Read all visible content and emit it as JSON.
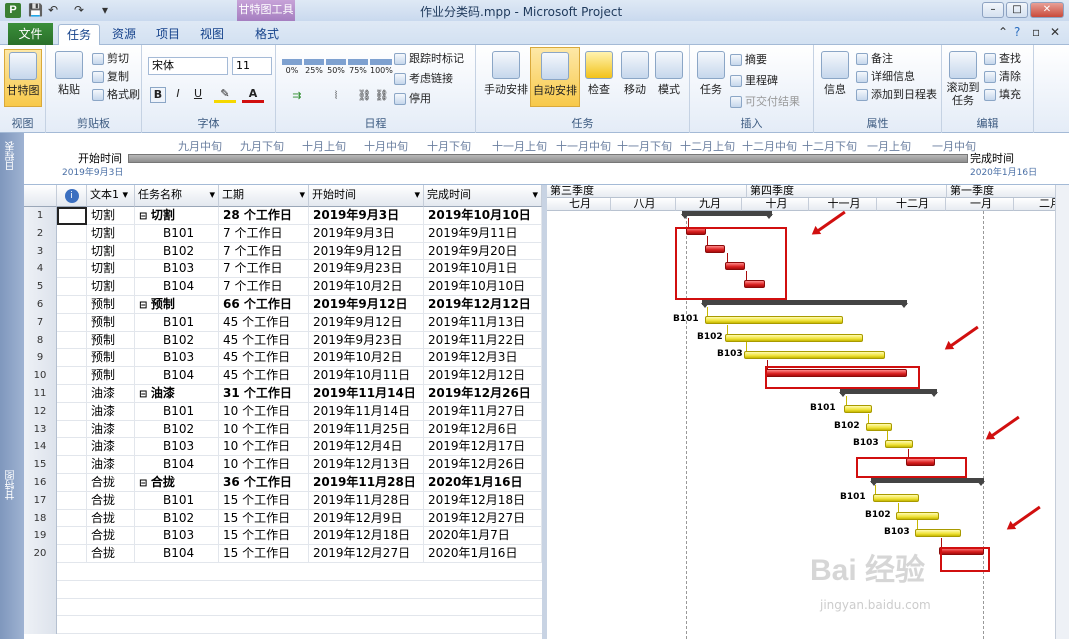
{
  "titlebar": {
    "app_icon": "P",
    "ctx_tab": "甘特图工具",
    "title": "作业分类码.mpp - Microsoft Project",
    "qat": [
      "save-icon",
      "undo-icon",
      "redo-icon",
      "customize-icon"
    ]
  },
  "tabs": [
    "文件",
    "任务",
    "资源",
    "项目",
    "视图",
    "格式"
  ],
  "ribbon": {
    "view_group": {
      "label": "视图",
      "button": "甘特图"
    },
    "clipboard": {
      "label": "剪贴板",
      "paste": "粘贴",
      "cut": "剪切",
      "copy": "复制",
      "format_painter": "格式刷"
    },
    "font": {
      "label": "字体",
      "font_name": "宋体",
      "font_size": "11",
      "bold": "B",
      "italic": "I",
      "underline": "U"
    },
    "schedule": {
      "label": "日程",
      "pcts": [
        "0%",
        "25%",
        "50%",
        "75%",
        "100%"
      ],
      "track": "跟踪时标记",
      "respect": "考虑链接",
      "inactivate": "停用"
    },
    "tasks": {
      "label": "任务",
      "manual": "手动安排",
      "auto": "自动安排",
      "inspect": "检查",
      "move": "移动",
      "mode": "模式"
    },
    "insert": {
      "label": "插入",
      "task": "任务",
      "summary": "摘要",
      "milestone": "里程碑",
      "deliverable": "可交付结果"
    },
    "properties": {
      "label": "属性",
      "info": "信息",
      "notes": "备注",
      "details": "详细信息",
      "add_timeline": "添加到日程表"
    },
    "editing": {
      "label": "编辑",
      "scroll": "滚动到任务",
      "find": "查找",
      "clear": "清除",
      "fill": "填充"
    }
  },
  "timeline": {
    "side_label": "日程表",
    "start_label": "开始时间",
    "start_date": "2019年9月3日",
    "finish_label": "完成时间",
    "finish_date": "2020年1月16日",
    "months": [
      "九月中旬",
      "九月下旬",
      "十月上旬",
      "十月中旬",
      "十月下旬",
      "十一月上旬",
      "十一月中旬",
      "十一月下旬",
      "十二月上旬",
      "十二月中旬",
      "十二月下旬",
      "一月上旬",
      "一月中旬"
    ]
  },
  "grid": {
    "side_label": "甘特图",
    "headers": {
      "info": "i",
      "text1": "文本1",
      "name": "任务名称",
      "duration": "工期",
      "start": "开始时间",
      "finish": "完成时间"
    },
    "rows": [
      {
        "n": "1",
        "t": "切割",
        "name": "切割",
        "dur": "28 个工作日",
        "start": "2019年9月3日",
        "finish": "2019年10月10日",
        "summary": true
      },
      {
        "n": "2",
        "t": "切割",
        "name": "B101",
        "dur": "7 个工作日",
        "start": "2019年9月3日",
        "finish": "2019年9月11日"
      },
      {
        "n": "3",
        "t": "切割",
        "name": "B102",
        "dur": "7 个工作日",
        "start": "2019年9月12日",
        "finish": "2019年9月20日"
      },
      {
        "n": "4",
        "t": "切割",
        "name": "B103",
        "dur": "7 个工作日",
        "start": "2019年9月23日",
        "finish": "2019年10月1日"
      },
      {
        "n": "5",
        "t": "切割",
        "name": "B104",
        "dur": "7 个工作日",
        "start": "2019年10月2日",
        "finish": "2019年10月10日"
      },
      {
        "n": "6",
        "t": "预制",
        "name": "预制",
        "dur": "66 个工作日",
        "start": "2019年9月12日",
        "finish": "2019年12月12日",
        "summary": true
      },
      {
        "n": "7",
        "t": "预制",
        "name": "B101",
        "dur": "45 个工作日",
        "start": "2019年9月12日",
        "finish": "2019年11月13日"
      },
      {
        "n": "8",
        "t": "预制",
        "name": "B102",
        "dur": "45 个工作日",
        "start": "2019年9月23日",
        "finish": "2019年11月22日"
      },
      {
        "n": "9",
        "t": "预制",
        "name": "B103",
        "dur": "45 个工作日",
        "start": "2019年10月2日",
        "finish": "2019年12月3日"
      },
      {
        "n": "10",
        "t": "预制",
        "name": "B104",
        "dur": "45 个工作日",
        "start": "2019年10月11日",
        "finish": "2019年12月12日"
      },
      {
        "n": "11",
        "t": "油漆",
        "name": "油漆",
        "dur": "31 个工作日",
        "start": "2019年11月14日",
        "finish": "2019年12月26日",
        "summary": true
      },
      {
        "n": "12",
        "t": "油漆",
        "name": "B101",
        "dur": "10 个工作日",
        "start": "2019年11月14日",
        "finish": "2019年11月27日"
      },
      {
        "n": "13",
        "t": "油漆",
        "name": "B102",
        "dur": "10 个工作日",
        "start": "2019年11月25日",
        "finish": "2019年12月6日"
      },
      {
        "n": "14",
        "t": "油漆",
        "name": "B103",
        "dur": "10 个工作日",
        "start": "2019年12月4日",
        "finish": "2019年12月17日"
      },
      {
        "n": "15",
        "t": "油漆",
        "name": "B104",
        "dur": "10 个工作日",
        "start": "2019年12月13日",
        "finish": "2019年12月26日"
      },
      {
        "n": "16",
        "t": "合拢",
        "name": "合拢",
        "dur": "36 个工作日",
        "start": "2019年11月28日",
        "finish": "2020年1月16日",
        "summary": true
      },
      {
        "n": "17",
        "t": "合拢",
        "name": "B101",
        "dur": "15 个工作日",
        "start": "2019年11月28日",
        "finish": "2019年12月18日"
      },
      {
        "n": "18",
        "t": "合拢",
        "name": "B102",
        "dur": "15 个工作日",
        "start": "2019年12月9日",
        "finish": "2019年12月27日"
      },
      {
        "n": "19",
        "t": "合拢",
        "name": "B103",
        "dur": "15 个工作日",
        "start": "2019年12月18日",
        "finish": "2020年1月7日"
      },
      {
        "n": "20",
        "t": "合拢",
        "name": "B104",
        "dur": "15 个工作日",
        "start": "2019年12月27日",
        "finish": "2020年1月16日"
      }
    ]
  },
  "gantt": {
    "quarters": [
      "第三季度",
      "第四季度",
      "第一季度"
    ],
    "months": [
      "七月",
      "八月",
      "九月",
      "十月",
      "十一月",
      "十二月",
      "一月",
      "二月"
    ],
    "bar_labels": [
      "B101",
      "B102",
      "B103",
      "B101",
      "B102",
      "B103",
      "B101",
      "B102",
      "B103"
    ]
  },
  "watermark": {
    "main": "Bai 经验",
    "sub": "jingyan.baidu.com"
  }
}
